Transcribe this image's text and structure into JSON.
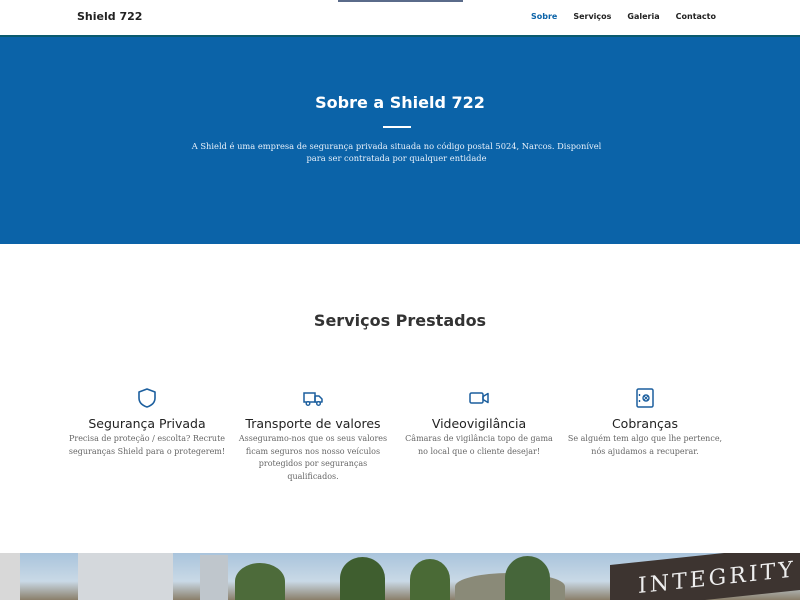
{
  "header": {
    "brand": "Shield 722",
    "nav": [
      {
        "label": "Sobre",
        "active": true
      },
      {
        "label": "Serviços",
        "active": false
      },
      {
        "label": "Galeria",
        "active": false
      },
      {
        "label": "Contacto",
        "active": false
      }
    ]
  },
  "hero": {
    "title": "Sobre a Shield 722",
    "text": "A Shield é uma empresa de segurança privada situada no código postal 5024, Narcos. Disponível para ser contratada por qualquer entidade"
  },
  "services": {
    "title": "Serviços Prestados",
    "items": [
      {
        "icon": "shield-icon",
        "title": "Segurança Privada",
        "desc": "Precisa de proteção / escolta? Recrute seguranças Shield para o protegerem!"
      },
      {
        "icon": "truck-icon",
        "title": "Transporte de valores",
        "desc": "Asseguramo-nos que os seus valores ficam seguros nos nosso veículos protegidos por seguranças qualificados."
      },
      {
        "icon": "video-camera-icon",
        "title": "Videovigilância",
        "desc": "Câmaras de vigilância topo de gama no local que o cliente desejar!"
      },
      {
        "icon": "safe-icon",
        "title": "Cobranças",
        "desc": "Se alguém tem algo que lhe pertence, nós ajudamos a recuperar."
      }
    ]
  },
  "photo": {
    "sign_text": "INTEGRITY"
  },
  "colors": {
    "primary": "#0b63a8",
    "header_border": "#0a5a6e",
    "icon": "#1c5f9e"
  }
}
